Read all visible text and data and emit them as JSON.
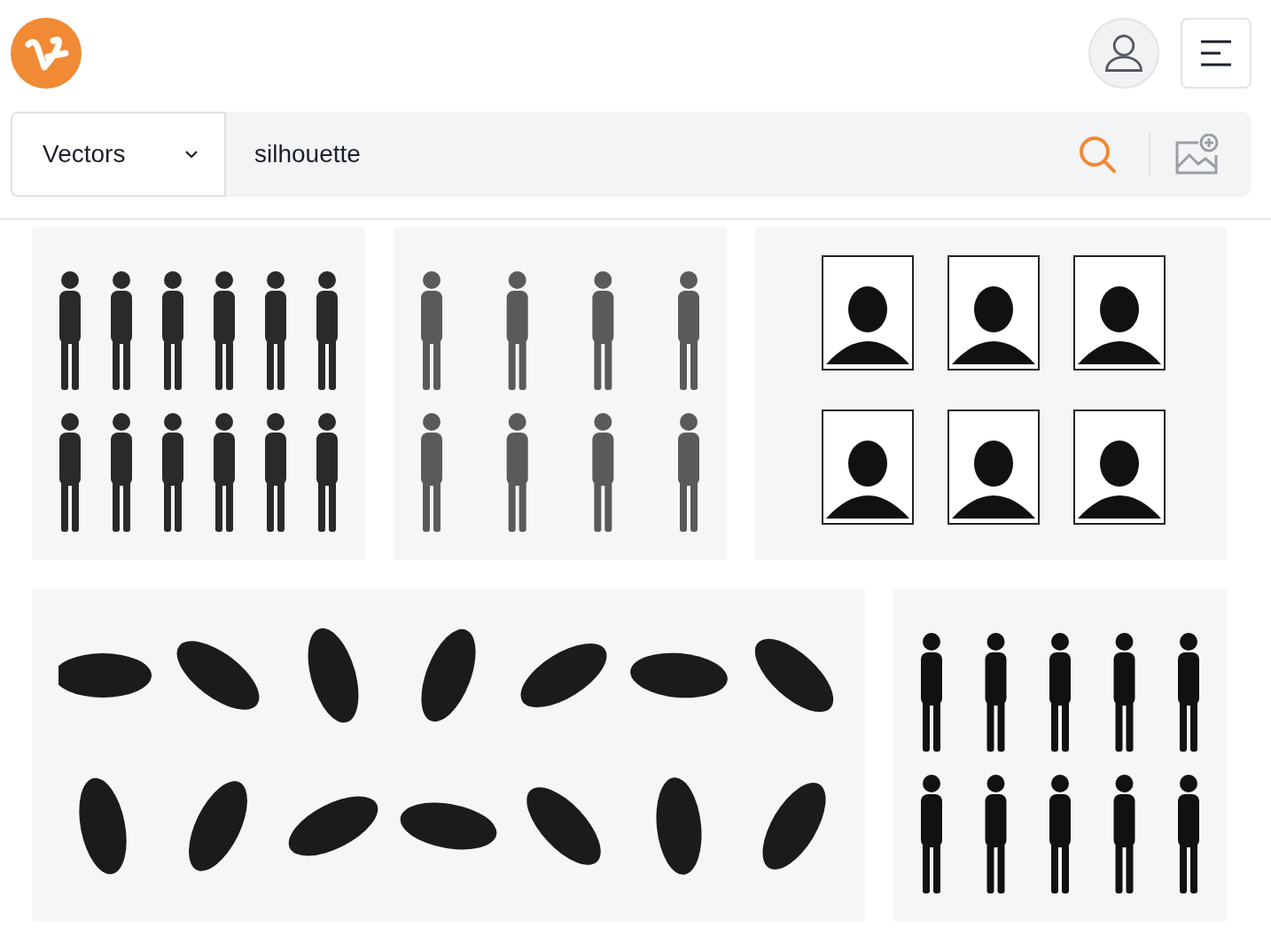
{
  "search": {
    "category": "Vectors",
    "value": "silhouette"
  }
}
